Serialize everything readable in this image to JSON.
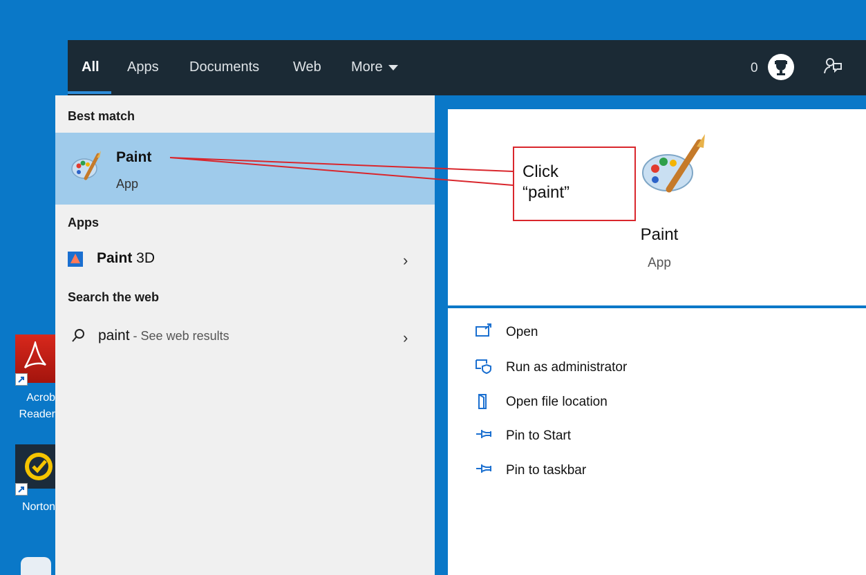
{
  "tabs": [
    {
      "label": "All"
    },
    {
      "label": "Apps"
    },
    {
      "label": "Documents"
    },
    {
      "label": "Web"
    },
    {
      "label": "More"
    }
  ],
  "header": {
    "points": "0"
  },
  "results": {
    "best_match_label": "Best match",
    "best_match": {
      "title": "Paint",
      "subtitle": "App"
    },
    "apps_label": "Apps",
    "apps": [
      {
        "title_bold": "Paint",
        "title_rest": " 3D"
      }
    ],
    "web_label": "Search the web",
    "web": {
      "query": "paint",
      "suffix": " - See web results"
    }
  },
  "detail": {
    "title": "Paint",
    "subtitle": "App",
    "actions": [
      {
        "label": "Open",
        "icon": "open-icon"
      },
      {
        "label": "Run as administrator",
        "icon": "shield-icon"
      },
      {
        "label": "Open file location",
        "icon": "file-location-icon"
      },
      {
        "label": "Pin to Start",
        "icon": "pin-icon"
      },
      {
        "label": "Pin to taskbar",
        "icon": "pin-icon"
      }
    ]
  },
  "desktop": {
    "icons": [
      {
        "label": "Acrob\nReader"
      },
      {
        "label": "Norton"
      }
    ]
  },
  "annotation": {
    "text": "Click\n“paint”"
  },
  "colors": {
    "desktop": "#0a78c8",
    "topbar": "#1b2a35",
    "selection": "#9fcbeb",
    "accent": "#2d8ddb",
    "annotation": "#d9262c"
  }
}
